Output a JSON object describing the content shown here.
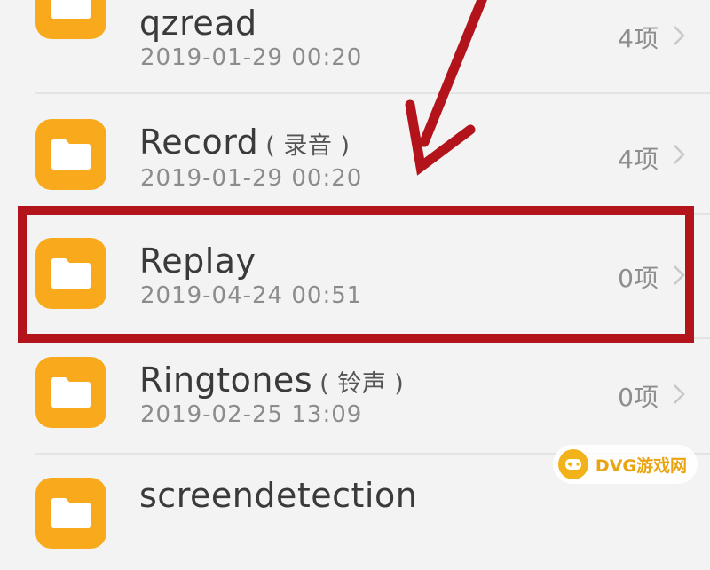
{
  "items": [
    {
      "name": "qzread",
      "note": "",
      "date": "2019-01-29 00:20",
      "count": "4项"
    },
    {
      "name": "Record",
      "note": "( 录音 )",
      "date": "2019-01-29 00:20",
      "count": "4项"
    },
    {
      "name": "Replay",
      "note": "",
      "date": "2019-04-24 00:51",
      "count": "0项"
    },
    {
      "name": "Ringtones",
      "note": "( 铃声 )",
      "date": "2019-02-25 13:09",
      "count": "0项"
    },
    {
      "name": "screendetection",
      "note": "",
      "date": "",
      "count": ""
    }
  ],
  "highlighted_item": "Replay",
  "colors": {
    "folder": "#f8aa1c",
    "highlight": "#b3131a"
  },
  "icons": {
    "folder": "folder-icon",
    "chevron": "chevron-right-icon"
  },
  "watermark": {
    "text": "DVG游戏网"
  }
}
